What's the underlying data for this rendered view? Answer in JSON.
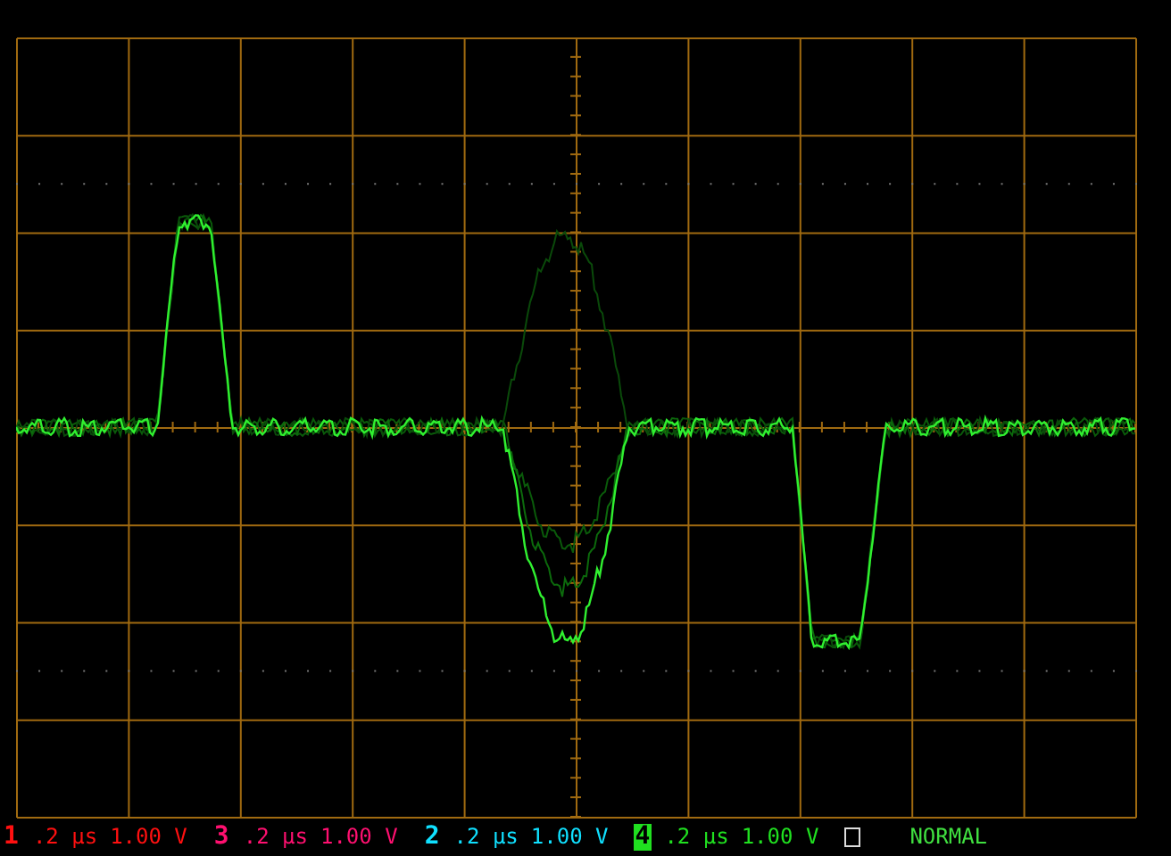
{
  "channels": [
    {
      "number": "1",
      "timebase": ".2 µs",
      "volts": "1.00 V",
      "color": "#ff1010",
      "selected": false
    },
    {
      "number": "3",
      "timebase": ".2 µs",
      "volts": "1.00 V",
      "color": "#ff1070",
      "selected": false
    },
    {
      "number": "2",
      "timebase": ".2 µs",
      "volts": "1.00 V",
      "color": "#10e0ff",
      "selected": false
    },
    {
      "number": "4",
      "timebase": ".2 µs",
      "volts": "1.00 V",
      "color": "#20e020",
      "selected": true
    }
  ],
  "mode": "NORMAL"
}
